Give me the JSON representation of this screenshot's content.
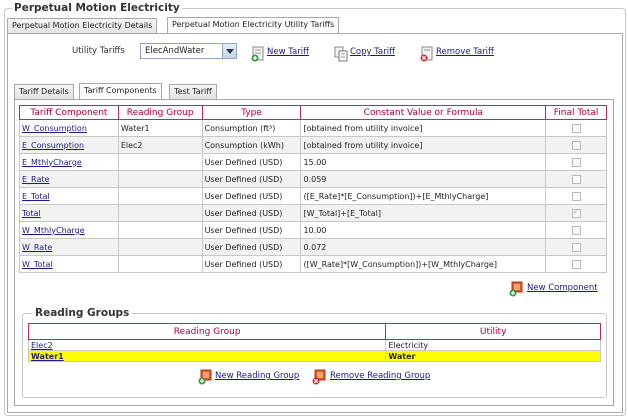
{
  "window": {
    "title": "Perpetual Motion Electricity"
  },
  "outer_tabs": [
    {
      "label": "Perpetual Motion Electricity Details",
      "active": false
    },
    {
      "label": "Perpetual Motion Electricity Utility Tariffs",
      "active": true
    }
  ],
  "utility_tariffs": {
    "label": "Utility Tariffs",
    "selected": "ElecAndWater",
    "new_label": "New Tariff",
    "copy_label": "Copy Tariff",
    "remove_label": "Remove Tariff"
  },
  "inner_tabs": [
    {
      "label": "Tariff Details",
      "active": false
    },
    {
      "label": "Tariff Components",
      "active": true
    },
    {
      "label": "Test Tariff",
      "active": false
    }
  ],
  "components_table": {
    "headers": [
      "Tariff Component",
      "Reading Group",
      "Type",
      "Constant Value or Formula",
      "Final Total"
    ],
    "rows": [
      {
        "component": "W_Consumption",
        "reading_group": "Water1",
        "type": "Consumption (ft³)",
        "value": "[obtained from utility invoice]",
        "final_total": false
      },
      {
        "component": "E_Consumption",
        "reading_group": "Elec2",
        "type": "Consumption (kWh)",
        "value": "[obtained from utility invoice]",
        "final_total": false
      },
      {
        "component": "E_MthlyCharge",
        "reading_group": "",
        "type": "User Defined (USD)",
        "value": "15.00",
        "final_total": false
      },
      {
        "component": "E_Rate",
        "reading_group": "",
        "type": "User Defined (USD)",
        "value": "0.059",
        "final_total": false
      },
      {
        "component": "E_Total",
        "reading_group": "",
        "type": "User Defined (USD)",
        "value": "([E_Rate]*[E_Consumption])+[E_MthlyCharge]",
        "final_total": false
      },
      {
        "component": "Total",
        "reading_group": "",
        "type": "User Defined (USD)",
        "value": "[W_Total]+[E_Total]",
        "final_total": true
      },
      {
        "component": "W_MthlyCharge",
        "reading_group": "",
        "type": "User Defined (USD)",
        "value": "10.00",
        "final_total": false
      },
      {
        "component": "W_Rate",
        "reading_group": "",
        "type": "User Defined (USD)",
        "value": "0.072",
        "final_total": false
      },
      {
        "component": "W_Total",
        "reading_group": "",
        "type": "User Defined (USD)",
        "value": "([W_Rate]*[W_Consumption])+[W_MthlyCharge]",
        "final_total": false
      }
    ],
    "new_component_label": "New Component"
  },
  "reading_groups": {
    "title": "Reading Groups",
    "headers": [
      "Reading Group",
      "Utility"
    ],
    "rows": [
      {
        "group": "Elec2",
        "utility": "Electricity",
        "selected": false
      },
      {
        "group": "Water1",
        "utility": "Water",
        "selected": true
      }
    ],
    "new_label": "New Reading Group",
    "remove_label": "Remove Reading Group"
  },
  "colors": {
    "header_text": "#b0003a",
    "link": "#1a1a8a",
    "selected_row": "#ffff00"
  }
}
